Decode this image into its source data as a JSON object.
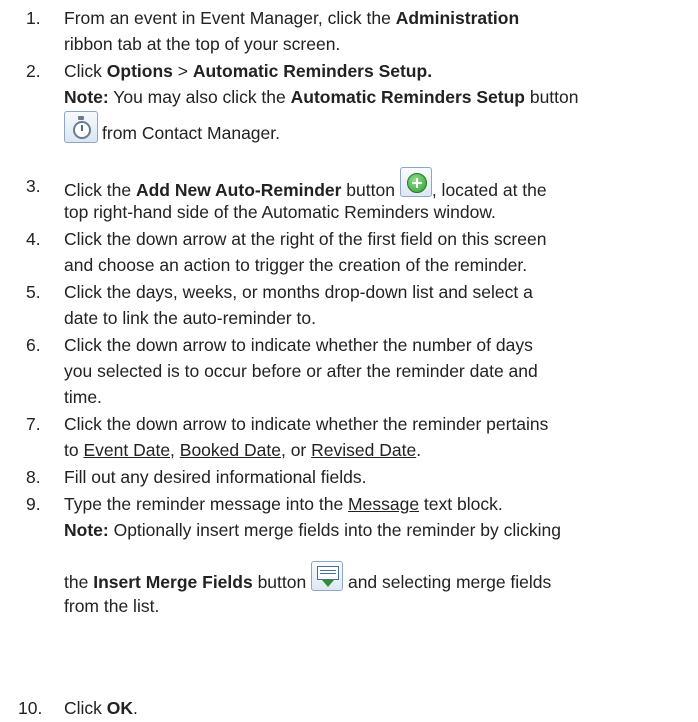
{
  "steps": [
    {
      "n": "1.",
      "l1_pre": "From an event in Event Manager, click the ",
      "l1_bold": "Administration",
      "l2": "ribbon tab at the top of your screen."
    },
    {
      "n": "2.",
      "l1_pre": "Click ",
      "l1_b1": "Options",
      "l1_sep": " > ",
      "l1_b2": "Automatic Reminders Setup.",
      "note_label": "Note:",
      "note_pre": " You may also click the ",
      "note_bold": "Automatic Reminders Setup",
      "note_post": " button",
      "icon_name": "timer-icon",
      "l3": "from Contact Manager."
    },
    {
      "n": "3.",
      "l1_pre": "Click the ",
      "l1_bold": "Add New Auto-Reminder",
      "l1_mid": " button ",
      "l1_post": ", located at the",
      "icon_name": "add-circle-icon",
      "l2": "top right-hand side of the Automatic Reminders window."
    },
    {
      "n": "4.",
      "l1": "Click the down arrow at the right of the first field on this screen",
      "l2": "and choose an action to trigger the creation of the reminder."
    },
    {
      "n": "5.",
      "l1": "Click the days, weeks, or months drop-down list and select a",
      "l2": "date to link the auto-reminder to."
    },
    {
      "n": "6.",
      "l1": "Click the down arrow to indicate whether the number of days",
      "l2": "you selected is to occur before or after the reminder date and",
      "l3": "time."
    },
    {
      "n": "7.",
      "l1": "Click the down arrow to indicate whether the reminder pertains",
      "l2_pre": "to ",
      "l2_u1": "Event Date",
      "l2_s1": ", ",
      "l2_u2": "Booked Date",
      "l2_s2": ", or ",
      "l2_u3": "Revised Date",
      "l2_post": "."
    },
    {
      "n": "8.",
      "l1": "Fill out any desired informational fields."
    },
    {
      "n": "9.",
      "l1_pre": "Type the reminder message into the ",
      "l1_u": "Message",
      "l1_post": " text block.",
      "note_label": "Note:",
      "note_text": " Optionally insert merge fields into the reminder by clicking",
      "l3_pre": "the ",
      "l3_bold": "Insert Merge Fields",
      "l3_mid": " button ",
      "l3_post": " and selecting merge fields",
      "icon_name": "insert-merge-fields-icon",
      "l4": "from the list."
    },
    {
      "n": "10.",
      "l1_pre": "Click ",
      "l1_bold": "OK",
      "l1_post": "."
    }
  ]
}
